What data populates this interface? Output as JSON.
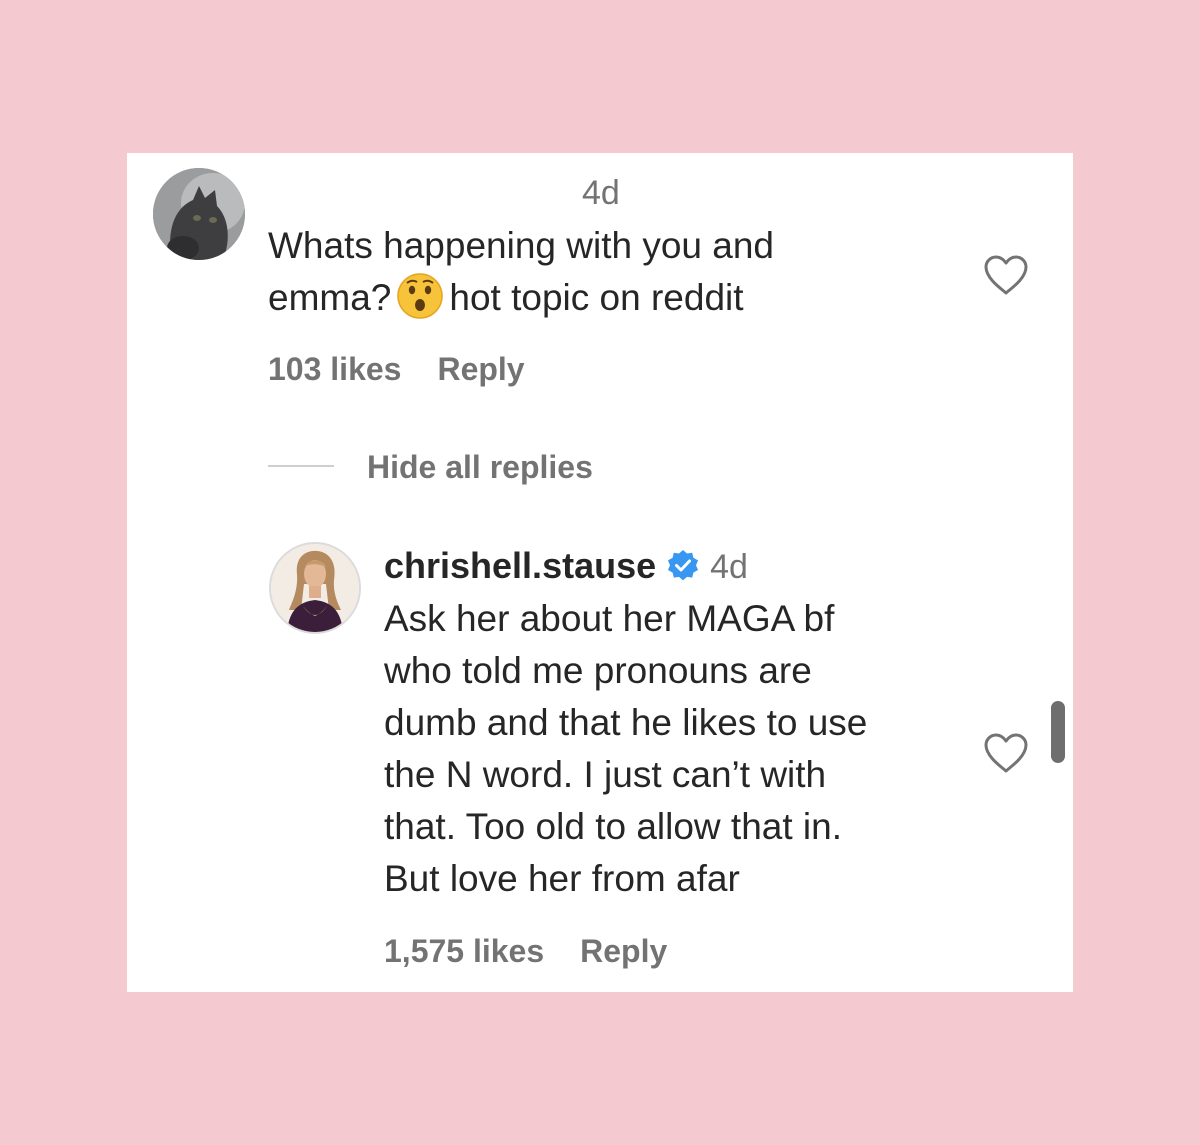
{
  "comment": {
    "username": "",
    "timestamp": "4d",
    "text_line1": "Whats happening with you and",
    "text_line2_before_emoji": "emma?",
    "emoji": "hushed-face-emoji",
    "text_line2_after_emoji": "hot topic on reddit",
    "likes": "103 likes",
    "reply_label": "Reply"
  },
  "replies_toggle": {
    "label": "Hide all replies"
  },
  "reply": {
    "username": "chrishell.stause",
    "verified": true,
    "timestamp": "4d",
    "lines": [
      "Ask her about her MAGA bf",
      "who told me pronouns are",
      "dumb and that he likes to use",
      "the N word. I just can’t with",
      "that. Too old to allow that in.",
      "But love her from afar"
    ],
    "likes": "1,575 likes",
    "reply_label": "Reply"
  },
  "colors": {
    "background": "#f5c9d0",
    "card": "#ffffff",
    "text": "#262626",
    "secondary_text": "#737373",
    "verified_badge": "#3897f0"
  },
  "icons": [
    "heart-icon",
    "verified-badge-icon",
    "hushed-face-emoji"
  ]
}
